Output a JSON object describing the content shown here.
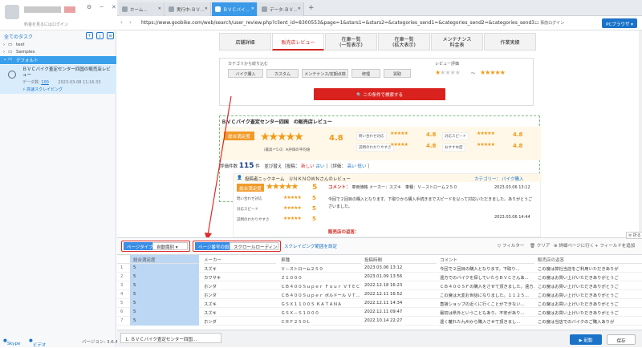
{
  "left": {
    "user_sub": "料金を見るにはログイン",
    "all_tasks": "全てのタスク",
    "tree": [
      {
        "label": "test"
      },
      {
        "label": "Samples"
      }
    ],
    "default_group": "デフォルト",
    "task": {
      "title": "ＢＶＣバイク査定センター四国の販売店レビュー",
      "count_label": "データ数:",
      "count": "100",
      "date": "2023-03-08 11:16:33",
      "speed_link": "高速スクレイピング"
    },
    "footer": {
      "skype": "Skype",
      "video": "ビデオ",
      "version": "バージョン: 3.6.4"
    }
  },
  "tabs": [
    {
      "label": "ホーム..."
    },
    {
      "label": "実行中-ＢＶ..."
    },
    {
      "label": "ＢＶＣバイ..."
    },
    {
      "label": "データ-ＢＶ..."
    }
  ],
  "address": {
    "url": "https://www.goobike.com/web/search/user_review.php?client_id=8300553&page=1&stars1=&stars2=&categories_send1=&categories_send2=&categories_send3...",
    "login": "事前ログイン",
    "pc_browser": "PCブラウザ"
  },
  "web": {
    "navtabs": [
      {
        "label": "店舗詳細"
      },
      {
        "label": "販売店レビュー"
      },
      {
        "label": "在庫一覧\n(一覧表示)"
      },
      {
        "label": "在庫一覧\n(拡大表示)"
      },
      {
        "label": "メンテナンス\n料金表"
      },
      {
        "label": "作業実績"
      }
    ],
    "filter": {
      "category_label": "カテゴリから絞り込む",
      "categories": [
        "バイク購入",
        "カスタム",
        "メンテナンス/定期点検",
        "修理",
        "買取"
      ],
      "rating_label": "レビュー評価",
      "tilde": "〜",
      "search_button": "この条件で検索する"
    },
    "review_title": "ＢＶＣバイク査定センター四国　の販売店レビュー",
    "summary": {
      "badge": "総合満足度",
      "score": "4.8",
      "note": "（最高＝5.0）※評価の平均値",
      "items": [
        {
          "label": "問い合わせ対応",
          "score": "4.8"
        },
        {
          "label": "対応スピード",
          "score": "4.8"
        },
        {
          "label": "説明のわかりやすさ",
          "score": "4.8"
        },
        {
          "label": "おすすめ度",
          "score": "4.8"
        }
      ]
    },
    "count": {
      "prefix": "評価件数",
      "number": "115",
      "suffix": "件　並び替え［投稿：",
      "new": "新しい",
      "old": "古い",
      "mid": "］［評価：",
      "high": "高い",
      "low": "低い",
      "end": "］"
    },
    "review": {
      "poster": "投稿者ニックネーム　ＵＮＫＮＯＷＮさんのレビュー",
      "category_label": "カテゴリー：",
      "category": "バイク購入",
      "badge": "総合満足度",
      "overall": "5",
      "ratings": [
        {
          "label": "問い合わせ対応",
          "score": "5"
        },
        {
          "label": "対応スピード",
          "score": "5"
        },
        {
          "label": "説明のわかりやすさ",
          "score": "5"
        }
      ],
      "comment_label": "コメント：",
      "comment_head": "車両価格 メーカー：スズキ　車種：Ｖ－ストローム２５０",
      "date1": "2023.03.06 13:12",
      "comment_body1": "今回で２回目の購入となります。下取りから購入手続きまでスピードを以って対応いただきました。ありがとうご",
      "comment_body2": "ざいました。",
      "date2": "2023.03.06 14:44",
      "reply_label": "販売店の返答："
    }
  },
  "toolbar": {
    "page_type_label": "ページタイプ",
    "page_type_value": "自動識別",
    "paging_label": "ページ番号の設定",
    "paging_value": "スクロールローディン",
    "scrape_link": "スクレイピング範囲を設定",
    "collapse": "折る",
    "filter": "フィルター",
    "clear": "クリア",
    "detail": "詳細ページに行く",
    "add_field": "フィールドを追加"
  },
  "grid": {
    "columns": [
      "総合満足度",
      "メーカー",
      "車種",
      "投稿時間",
      "コメント",
      "販売店の返答"
    ],
    "rows": [
      {
        "n": "1",
        "score": "5",
        "maker": "スズキ",
        "model": "Ｖ－ストローム２５０",
        "time": "2023.03.06 13:12",
        "comment": "今回で２回目の購入となります。下取り...",
        "reply": "この度は弊社当店をご利用いただきありが"
      },
      {
        "n": "2",
        "score": "5",
        "maker": "カワサキ",
        "model": "Ｚ１０００",
        "time": "2023.01.09 13:56",
        "comment": "遠方でのバイクを探していたらＢＶＣさんあ...",
        "reply": "この度はお買い上げいただきありがとうご"
      },
      {
        "n": "3",
        "score": "5",
        "maker": "ホンダ",
        "model": "ＣＢ４００Ｓｕｐｅｒ Ｆｏｕｒ ＶＴＥＣ",
        "time": "2022.12.18 16:23",
        "comment": "ＣＢ４００ＳＦの購入をさせて頂きました。遠方...",
        "reply": "この度はお買い上げいただきありがとうご"
      },
      {
        "n": "4",
        "score": "5",
        "maker": "ホンダ",
        "model": "ＣＢ４００Ｓｕｐｅｒ ボルドール ＶＴ...",
        "time": "2022.12.11 16:52",
        "comment": "この度は大変お世話になりました。１１２５...",
        "reply": "この度はお買い上げいただきありがとうご"
      },
      {
        "n": "5",
        "score": "5",
        "maker": "スズキ",
        "model": "ＧＳＸ１１００Ｓ ＫＡＴＡＮＡ",
        "time": "2022.12.11 14:34",
        "comment": "直接ショップの近くに行くことができない...",
        "reply": "この度はお買い上げいただきありがとうご"
      },
      {
        "n": "6",
        "score": "5",
        "maker": "スズキ",
        "model": "ＧＳＸ－Ｓ１０００",
        "time": "2022.12.11 09:47",
        "comment": "最初は県外ということもあり、不安があり...",
        "reply": "この度はお買い上げいただきありがとうご"
      },
      {
        "n": "7",
        "score": "5",
        "maker": "ホンダ",
        "model": "ＣＲＦ２５０Ｌ",
        "time": "2022.10.14 22:27",
        "comment": "遠く離れた九州から購入させて頂きまし...",
        "reply": "この度は当店でのバイクのご購入ありが"
      }
    ]
  },
  "bottom": {
    "task_tab": "1. ＢＶＣバイク査定センター四国...",
    "run": "▶ 起動",
    "save": "保存"
  },
  "colors": {
    "accent": "#1a73c8",
    "highlight": "#e02a2a",
    "star": "#f29a17",
    "brand_red": "#d1261d"
  }
}
